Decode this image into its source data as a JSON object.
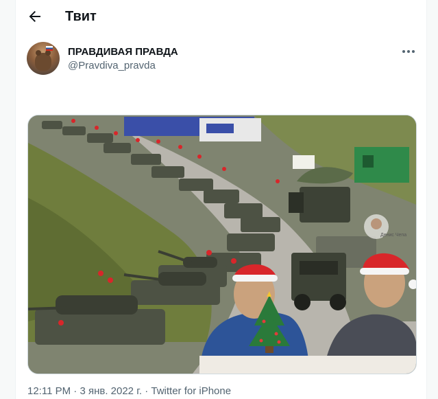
{
  "header": {
    "title": "Твит"
  },
  "tweet": {
    "author_name": "ПРАВДИВАЯ ПРАВДА",
    "author_handle": "@Pravdiva_pravda",
    "time": "12:11 PM",
    "separator": "·",
    "date": "3 янв. 2022 г.",
    "source": "Twitter for iPhone"
  },
  "media": {
    "watermark": "Денис Чепа"
  },
  "colors": {
    "text_primary": "#0f1419",
    "text_secondary": "#536471",
    "border": "#cfd9de"
  }
}
